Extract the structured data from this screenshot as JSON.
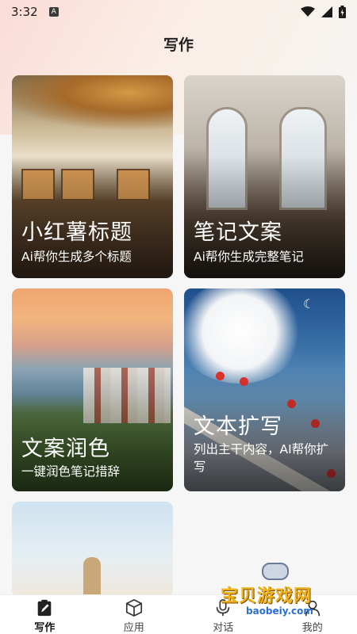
{
  "status_bar": {
    "time": "3:32",
    "app_badge": "A"
  },
  "header": {
    "title": "写作"
  },
  "cards": [
    {
      "title": "小红薯标题",
      "subtitle": "Ai帮你生成多个标题"
    },
    {
      "title": "笔记文案",
      "subtitle": "Ai帮你生成完整笔记"
    },
    {
      "title": "文案润色",
      "subtitle": "一键润色笔记措辞"
    },
    {
      "title": "文本扩写",
      "subtitle": "列出主干内容，AI帮你扩写"
    },
    {
      "title": "",
      "subtitle": ""
    }
  ],
  "tabbar": {
    "items": [
      {
        "label": "写作",
        "icon": "edit-clipboard-icon",
        "active": true
      },
      {
        "label": "应用",
        "icon": "cube-icon",
        "active": false
      },
      {
        "label": "对话",
        "icon": "microphone-icon",
        "active": false
      },
      {
        "label": "我的",
        "icon": "person-icon",
        "active": false
      }
    ]
  },
  "watermark": {
    "text_cn": "宝贝游戏网",
    "text_en": "baobeiy.com"
  },
  "colors": {
    "accent": "#222222",
    "watermark_gold": "#f0b21a",
    "watermark_blue": "#2b6fd1"
  }
}
